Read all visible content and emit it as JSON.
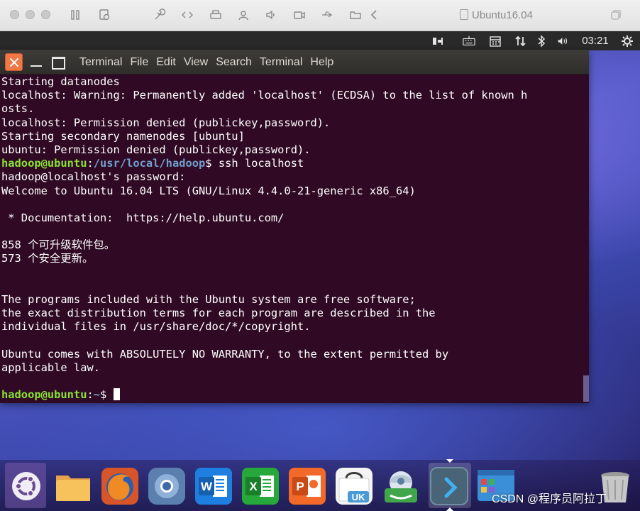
{
  "host": {
    "title": "Ubuntu16.04",
    "toolbar_icons": [
      "pause-icon",
      "snapshot-icon",
      "wrench-icon",
      "code-icon",
      "printer-icon",
      "user-icon",
      "volume-icon",
      "camera-icon",
      "usb-icon",
      "folder-icon",
      "back-chevron-icon"
    ]
  },
  "topbar": {
    "tray_icons": [
      "transfer-icon",
      "keyboard-icon",
      "calendar-icon",
      "network-icon",
      "bluetooth-icon",
      "volume-icon",
      "power-gear-icon"
    ],
    "clock": "03:21"
  },
  "terminal": {
    "menu": [
      "Terminal",
      "File",
      "Edit",
      "View",
      "Search",
      "Terminal",
      "Help"
    ],
    "lines": [
      {
        "text": "Starting datanodes"
      },
      {
        "text": "localhost: Warning: Permanently added 'localhost' (ECDSA) to the list of known h"
      },
      {
        "text": "osts."
      },
      {
        "text": "localhost: Permission denied (publickey,password)."
      },
      {
        "text": "Starting secondary namenodes [ubuntu]"
      },
      {
        "text": "ubuntu: Permission denied (publickey,password)."
      },
      {
        "prompt_user": "hadoop@ubuntu",
        "prompt_path": "/usr/local/hadoop",
        "text": "$ ssh localhost"
      },
      {
        "text": "hadoop@localhost's password:"
      },
      {
        "text": "Welcome to Ubuntu 16.04 LTS (GNU/Linux 4.4.0-21-generic x86_64)"
      },
      {
        "text": ""
      },
      {
        "text": " * Documentation:  https://help.ubuntu.com/"
      },
      {
        "text": ""
      },
      {
        "text": "858 个可升级软件包。"
      },
      {
        "text": "573 个安全更新。"
      },
      {
        "text": ""
      },
      {
        "text": ""
      },
      {
        "text": "The programs included with the Ubuntu system are free software;"
      },
      {
        "text": "the exact distribution terms for each program are described in the"
      },
      {
        "text": "individual files in /usr/share/doc/*/copyright."
      },
      {
        "text": ""
      },
      {
        "text": "Ubuntu comes with ABSOLUTELY NO WARRANTY, to the extent permitted by"
      },
      {
        "text": "applicable law."
      },
      {
        "text": ""
      },
      {
        "prompt_user": "hadoop@ubuntu",
        "prompt_path": "~",
        "text": "$ "
      }
    ]
  },
  "dock": {
    "apps": [
      {
        "name": "ubuntu-launcher-icon"
      },
      {
        "name": "files-icon"
      },
      {
        "name": "firefox-icon"
      },
      {
        "name": "chromium-icon"
      },
      {
        "name": "writer-icon",
        "letter": "W"
      },
      {
        "name": "calc-icon",
        "letter": "X"
      },
      {
        "name": "impress-icon",
        "letter": "P"
      },
      {
        "name": "software-center-icon",
        "letter": "UK"
      },
      {
        "name": "amazon-icon"
      },
      {
        "name": "terminal-app-icon"
      },
      {
        "name": "workspace-switcher-icon"
      },
      {
        "name": "trash-icon"
      }
    ]
  },
  "watermark": "CSDN @程序员阿拉丁"
}
